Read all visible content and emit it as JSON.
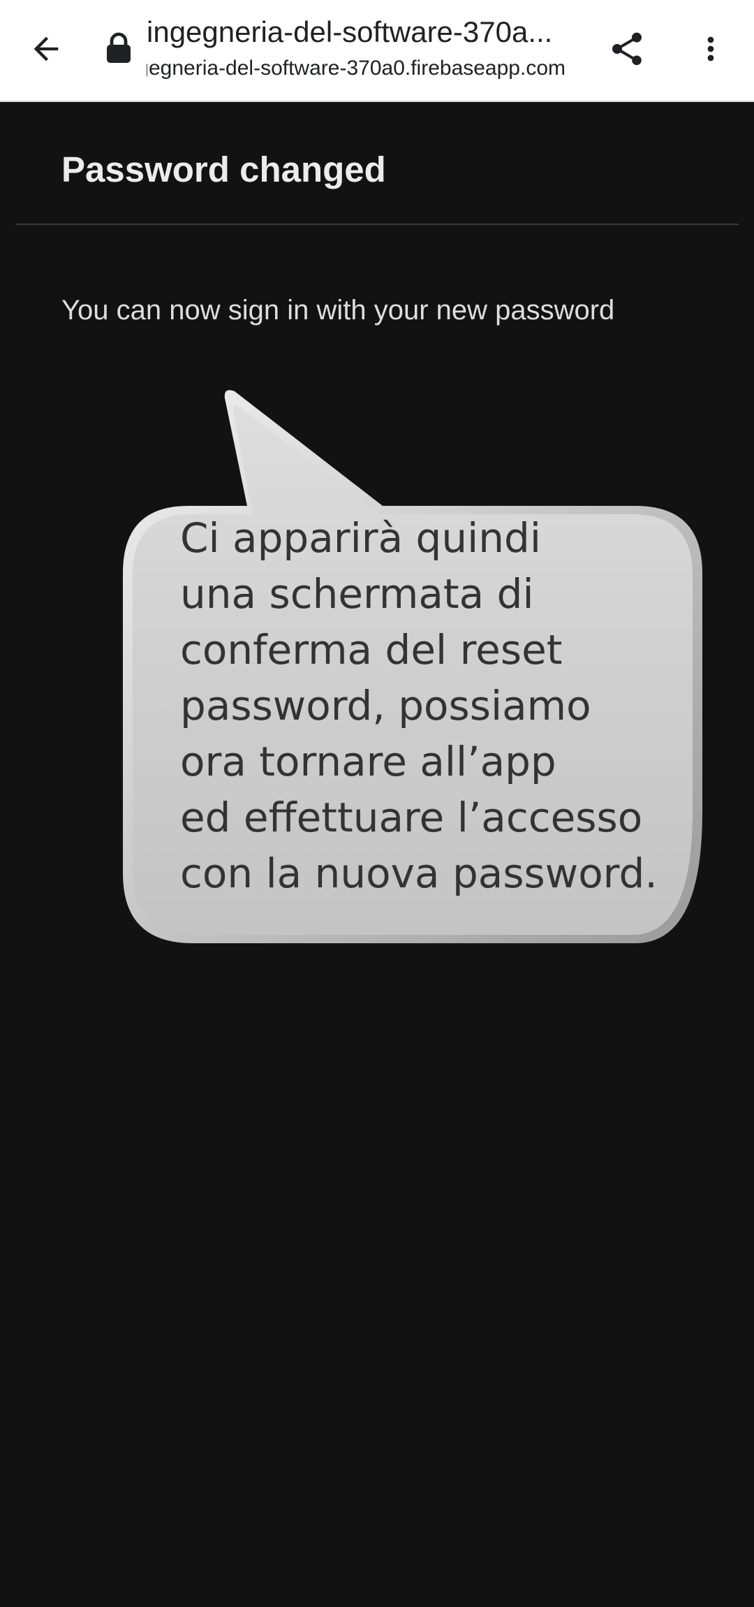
{
  "browser": {
    "page_title": "ingegneria-del-software-370a...",
    "url_host": "ingegneria-del-software-370a0.firebaseapp.com",
    "icons": {
      "back": "arrow-left-icon",
      "lock": "lock-icon",
      "share": "share-icon",
      "menu": "more-vert-icon"
    }
  },
  "card": {
    "title": "Password changed",
    "message": "You can now sign in with your new password"
  },
  "callout": {
    "lines": [
      "Ci apparirà quindi",
      "una schermata di",
      "conferma del reset",
      "password, possiamo",
      "ora tornare all’app",
      "ed effettuare l’accesso",
      "con la nuova password."
    ]
  },
  "colors": {
    "page_background": "#121212",
    "toolbar_background": "#ffffff",
    "title_text": "#ececec",
    "body_text": "#dedede",
    "bubble_fill": "#cfcfcf",
    "bubble_text": "#333333"
  }
}
